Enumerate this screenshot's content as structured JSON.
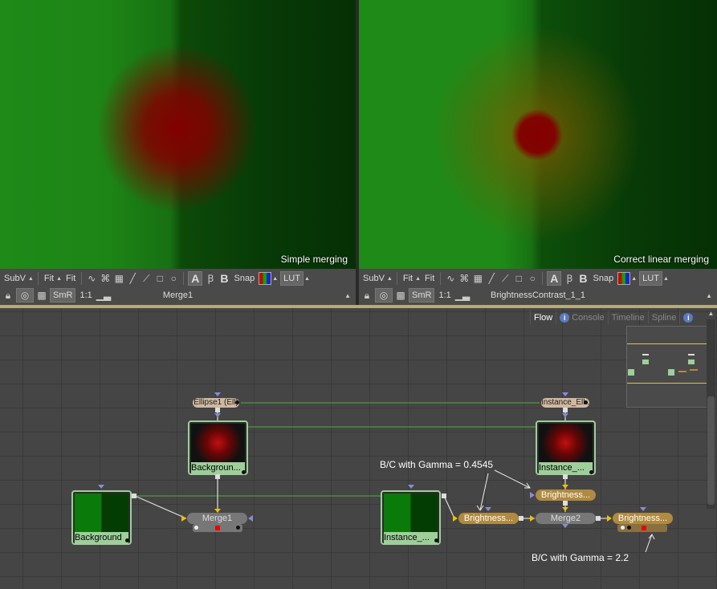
{
  "viewers": {
    "left": {
      "caption": "Simple merging",
      "node": "Merge1"
    },
    "right": {
      "caption": "Correct linear merging",
      "node": "BrightnessContrast_1_1"
    }
  },
  "toolbar": {
    "subv": "SubV",
    "fit1": "Fit",
    "fit2": "Fit",
    "a": "A",
    "b": "B",
    "snap": "Snap",
    "lut": "LUT",
    "smr": "SmR",
    "ratio": "1:1"
  },
  "tabs": [
    {
      "label": "Flow"
    },
    {
      "label": "Console"
    },
    {
      "label": "Timeline"
    },
    {
      "label": "Spline"
    }
  ],
  "nodes": {
    "ellipse": "Ellipse1 (Ell)",
    "instance_ellipse": "Instance_Ell...",
    "background_red": "Backgroun...",
    "instance_red": "Instance_...",
    "background_green": "Background",
    "instance_green": "Instance_...",
    "merge1": "Merge1",
    "merge2": "Merge2",
    "bc1": "Brightness...",
    "bc2": "Brightness...",
    "bc3": "Brightness..."
  },
  "annotations": {
    "gamma_0454": "B/C with Gamma = 0.4545",
    "gamma_22": "B/C with Gamma = 2.2"
  }
}
